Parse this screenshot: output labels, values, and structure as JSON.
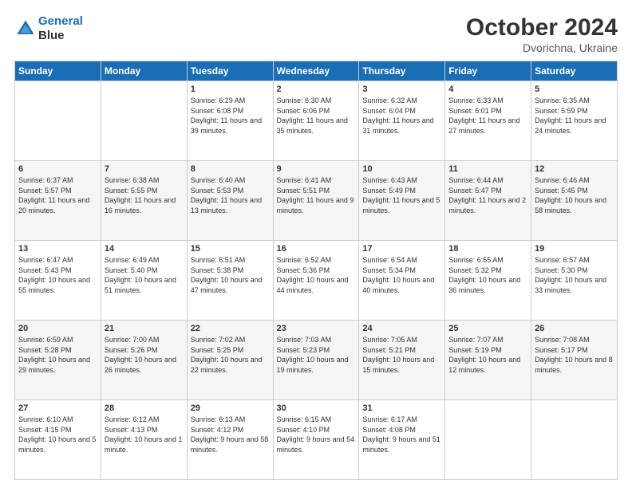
{
  "header": {
    "logo_line1": "General",
    "logo_line2": "Blue",
    "month": "October 2024",
    "location": "Dvorichna, Ukraine"
  },
  "days_of_week": [
    "Sunday",
    "Monday",
    "Tuesday",
    "Wednesday",
    "Thursday",
    "Friday",
    "Saturday"
  ],
  "weeks": [
    [
      {
        "day": "",
        "sunrise": "",
        "sunset": "",
        "daylight": ""
      },
      {
        "day": "",
        "sunrise": "",
        "sunset": "",
        "daylight": ""
      },
      {
        "day": "1",
        "sunrise": "Sunrise: 6:29 AM",
        "sunset": "Sunset: 6:08 PM",
        "daylight": "Daylight: 11 hours and 39 minutes."
      },
      {
        "day": "2",
        "sunrise": "Sunrise: 6:30 AM",
        "sunset": "Sunset: 6:06 PM",
        "daylight": "Daylight: 11 hours and 35 minutes."
      },
      {
        "day": "3",
        "sunrise": "Sunrise: 6:32 AM",
        "sunset": "Sunset: 6:04 PM",
        "daylight": "Daylight: 11 hours and 31 minutes."
      },
      {
        "day": "4",
        "sunrise": "Sunrise: 6:33 AM",
        "sunset": "Sunset: 6:01 PM",
        "daylight": "Daylight: 11 hours and 27 minutes."
      },
      {
        "day": "5",
        "sunrise": "Sunrise: 6:35 AM",
        "sunset": "Sunset: 5:59 PM",
        "daylight": "Daylight: 11 hours and 24 minutes."
      }
    ],
    [
      {
        "day": "6",
        "sunrise": "Sunrise: 6:37 AM",
        "sunset": "Sunset: 5:57 PM",
        "daylight": "Daylight: 11 hours and 20 minutes."
      },
      {
        "day": "7",
        "sunrise": "Sunrise: 6:38 AM",
        "sunset": "Sunset: 5:55 PM",
        "daylight": "Daylight: 11 hours and 16 minutes."
      },
      {
        "day": "8",
        "sunrise": "Sunrise: 6:40 AM",
        "sunset": "Sunset: 5:53 PM",
        "daylight": "Daylight: 11 hours and 13 minutes."
      },
      {
        "day": "9",
        "sunrise": "Sunrise: 6:41 AM",
        "sunset": "Sunset: 5:51 PM",
        "daylight": "Daylight: 11 hours and 9 minutes."
      },
      {
        "day": "10",
        "sunrise": "Sunrise: 6:43 AM",
        "sunset": "Sunset: 5:49 PM",
        "daylight": "Daylight: 11 hours and 5 minutes."
      },
      {
        "day": "11",
        "sunrise": "Sunrise: 6:44 AM",
        "sunset": "Sunset: 5:47 PM",
        "daylight": "Daylight: 11 hours and 2 minutes."
      },
      {
        "day": "12",
        "sunrise": "Sunrise: 6:46 AM",
        "sunset": "Sunset: 5:45 PM",
        "daylight": "Daylight: 10 hours and 58 minutes."
      }
    ],
    [
      {
        "day": "13",
        "sunrise": "Sunrise: 6:47 AM",
        "sunset": "Sunset: 5:43 PM",
        "daylight": "Daylight: 10 hours and 55 minutes."
      },
      {
        "day": "14",
        "sunrise": "Sunrise: 6:49 AM",
        "sunset": "Sunset: 5:40 PM",
        "daylight": "Daylight: 10 hours and 51 minutes."
      },
      {
        "day": "15",
        "sunrise": "Sunrise: 6:51 AM",
        "sunset": "Sunset: 5:38 PM",
        "daylight": "Daylight: 10 hours and 47 minutes."
      },
      {
        "day": "16",
        "sunrise": "Sunrise: 6:52 AM",
        "sunset": "Sunset: 5:36 PM",
        "daylight": "Daylight: 10 hours and 44 minutes."
      },
      {
        "day": "17",
        "sunrise": "Sunrise: 6:54 AM",
        "sunset": "Sunset: 5:34 PM",
        "daylight": "Daylight: 10 hours and 40 minutes."
      },
      {
        "day": "18",
        "sunrise": "Sunrise: 6:55 AM",
        "sunset": "Sunset: 5:32 PM",
        "daylight": "Daylight: 10 hours and 36 minutes."
      },
      {
        "day": "19",
        "sunrise": "Sunrise: 6:57 AM",
        "sunset": "Sunset: 5:30 PM",
        "daylight": "Daylight: 10 hours and 33 minutes."
      }
    ],
    [
      {
        "day": "20",
        "sunrise": "Sunrise: 6:59 AM",
        "sunset": "Sunset: 5:28 PM",
        "daylight": "Daylight: 10 hours and 29 minutes."
      },
      {
        "day": "21",
        "sunrise": "Sunrise: 7:00 AM",
        "sunset": "Sunset: 5:26 PM",
        "daylight": "Daylight: 10 hours and 26 minutes."
      },
      {
        "day": "22",
        "sunrise": "Sunrise: 7:02 AM",
        "sunset": "Sunset: 5:25 PM",
        "daylight": "Daylight: 10 hours and 22 minutes."
      },
      {
        "day": "23",
        "sunrise": "Sunrise: 7:03 AM",
        "sunset": "Sunset: 5:23 PM",
        "daylight": "Daylight: 10 hours and 19 minutes."
      },
      {
        "day": "24",
        "sunrise": "Sunrise: 7:05 AM",
        "sunset": "Sunset: 5:21 PM",
        "daylight": "Daylight: 10 hours and 15 minutes."
      },
      {
        "day": "25",
        "sunrise": "Sunrise: 7:07 AM",
        "sunset": "Sunset: 5:19 PM",
        "daylight": "Daylight: 10 hours and 12 minutes."
      },
      {
        "day": "26",
        "sunrise": "Sunrise: 7:08 AM",
        "sunset": "Sunset: 5:17 PM",
        "daylight": "Daylight: 10 hours and 8 minutes."
      }
    ],
    [
      {
        "day": "27",
        "sunrise": "Sunrise: 6:10 AM",
        "sunset": "Sunset: 4:15 PM",
        "daylight": "Daylight: 10 hours and 5 minutes."
      },
      {
        "day": "28",
        "sunrise": "Sunrise: 6:12 AM",
        "sunset": "Sunset: 4:13 PM",
        "daylight": "Daylight: 10 hours and 1 minute."
      },
      {
        "day": "29",
        "sunrise": "Sunrise: 6:13 AM",
        "sunset": "Sunset: 4:12 PM",
        "daylight": "Daylight: 9 hours and 58 minutes."
      },
      {
        "day": "30",
        "sunrise": "Sunrise: 6:15 AM",
        "sunset": "Sunset: 4:10 PM",
        "daylight": "Daylight: 9 hours and 54 minutes."
      },
      {
        "day": "31",
        "sunrise": "Sunrise: 6:17 AM",
        "sunset": "Sunset: 4:08 PM",
        "daylight": "Daylight: 9 hours and 51 minutes."
      },
      {
        "day": "",
        "sunrise": "",
        "sunset": "",
        "daylight": ""
      },
      {
        "day": "",
        "sunrise": "",
        "sunset": "",
        "daylight": ""
      }
    ]
  ]
}
